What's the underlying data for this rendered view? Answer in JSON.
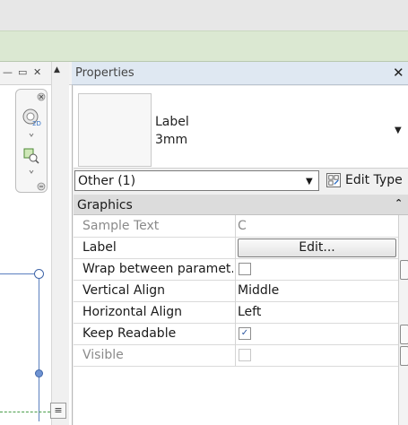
{
  "properties_panel": {
    "title": "Properties",
    "type_selector": {
      "name": "Label",
      "size": "3mm"
    },
    "filter": {
      "selected": "Other (1)"
    },
    "edit_type_label": "Edit Type",
    "group": {
      "name": "Graphics"
    },
    "rows": [
      {
        "name": "Sample Text",
        "value": "C"
      },
      {
        "name": "Label",
        "button": "Edit..."
      },
      {
        "name": "Wrap between paramet...",
        "checked": false
      },
      {
        "name": "Vertical Align",
        "value": "Middle"
      },
      {
        "name": "Horizontal Align",
        "value": "Left"
      },
      {
        "name": "Keep Readable",
        "checked": true
      },
      {
        "name": "Visible",
        "checked": false
      }
    ]
  },
  "glyphs": {
    "close": "✕",
    "dropdown": "▼",
    "collapse": "⌃",
    "scroll_up": "▲",
    "check": "✓",
    "minimize": "—",
    "restore": "▭",
    "view_close": "✕"
  },
  "colors": {
    "ribbon": "#dbe8d2",
    "title_bar": "#dfe8f2",
    "view_line": "#5b7fbf",
    "view_dash": "#4a9d4a"
  }
}
